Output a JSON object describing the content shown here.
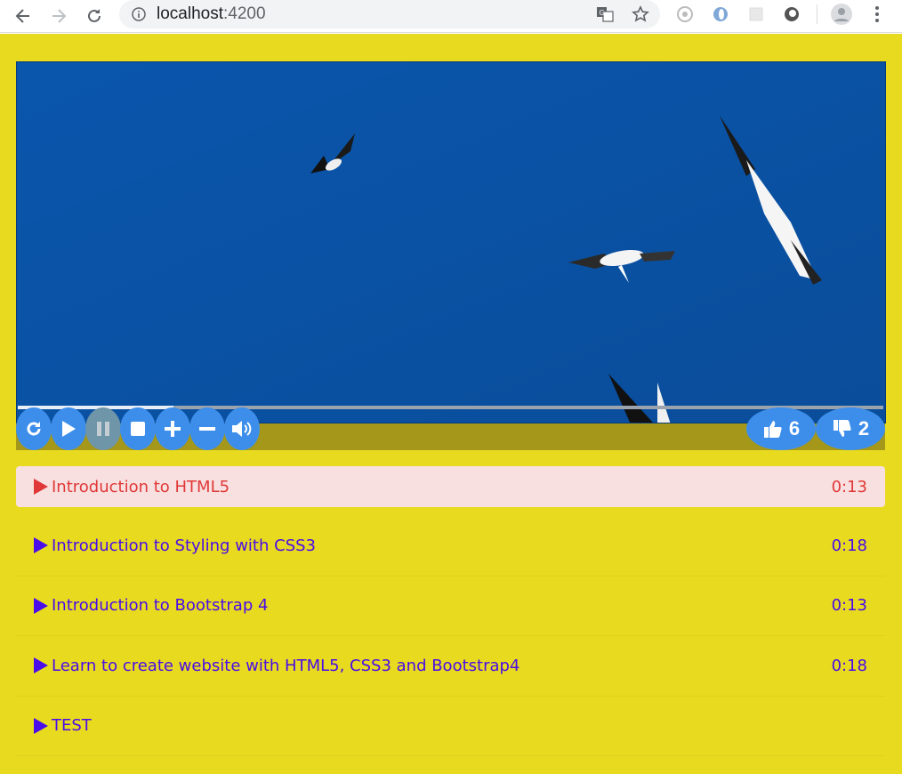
{
  "browser": {
    "url_host": "localhost",
    "url_port": ":4200"
  },
  "video": {
    "progress_fraction": 0.18
  },
  "votes": {
    "likes": "6",
    "dislikes": "2"
  },
  "playlist": {
    "items": [
      {
        "title": "Introduction to HTML5",
        "duration": "0:13",
        "active": true
      },
      {
        "title": "Introduction to Styling with CSS3",
        "duration": "0:18",
        "active": false
      },
      {
        "title": "Introduction to Bootstrap 4",
        "duration": "0:13",
        "active": false
      },
      {
        "title": "Learn to create website with HTML5, CSS3 and Bootstrap4",
        "duration": "0:18",
        "active": false
      },
      {
        "title": "TEST",
        "duration": "",
        "active": false
      }
    ]
  },
  "colors": {
    "page_bg": "#e8db1f",
    "accent_blue": "#3d8eeb",
    "link_purple": "#4a0ce8",
    "active_red": "#e03838",
    "active_bg": "#f7e0df"
  }
}
